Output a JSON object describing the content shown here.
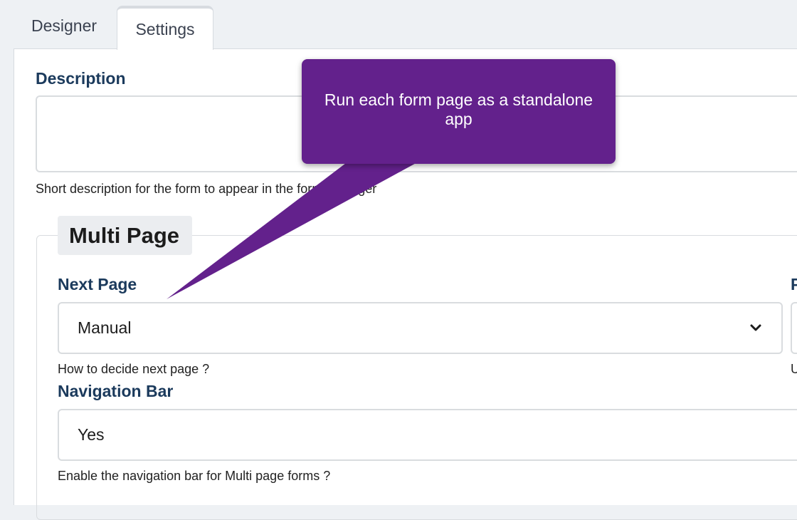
{
  "tabs": [
    {
      "label": "Designer",
      "active": false
    },
    {
      "label": "Settings",
      "active": true
    }
  ],
  "description": {
    "label": "Description",
    "value": "",
    "hint": "Short description for the form to appear in the form manager"
  },
  "multi_page": {
    "legend": "Multi Page",
    "next_page": {
      "label": "Next Page",
      "value": "Manual",
      "hint": "How to decide next page ?"
    },
    "right_field": {
      "label_fragment": "P",
      "hint_fragment": "U"
    },
    "navigation_bar": {
      "label": "Navigation Bar",
      "value": "Yes",
      "hint": "Enable the navigation bar for Multi page forms ?"
    }
  },
  "tooltip": {
    "text": "Run each form page as a standalone app",
    "color": "#63218c"
  },
  "icons": {
    "select_arrow": "chevron-down-icon"
  }
}
